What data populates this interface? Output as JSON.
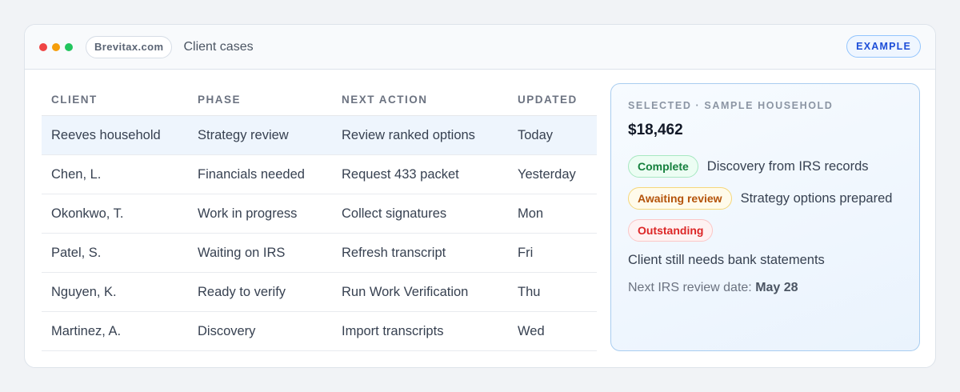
{
  "window": {
    "site": "Brevitax.com",
    "title": "Client cases",
    "badge": "EXAMPLE"
  },
  "table": {
    "headers": [
      "CLIENT",
      "PHASE",
      "NEXT ACTION",
      "UPDATED"
    ],
    "rows": [
      {
        "client": "Reeves household",
        "phase": "Strategy review",
        "next_action": "Review ranked options",
        "updated": "Today",
        "selected": true
      },
      {
        "client": "Chen, L.",
        "phase": "Financials needed",
        "next_action": "Request 433 packet",
        "updated": "Yesterday"
      },
      {
        "client": "Okonkwo, T.",
        "phase": "Work in progress",
        "next_action": "Collect signatures",
        "updated": "Mon"
      },
      {
        "client": "Patel, S.",
        "phase": "Waiting on IRS",
        "next_action": "Refresh transcript",
        "updated": "Fri"
      },
      {
        "client": "Nguyen, K.",
        "phase": "Ready to verify",
        "next_action": "Run Work Verification",
        "updated": "Thu"
      },
      {
        "client": "Martinez, A.",
        "phase": "Discovery",
        "next_action": "Import transcripts",
        "updated": "Wed"
      }
    ]
  },
  "panel": {
    "label": "SELECTED · SAMPLE HOUSEHOLD",
    "amount": "$18,462",
    "statuses": [
      {
        "badge": "Complete",
        "text": "Discovery from IRS records",
        "tone": "complete"
      },
      {
        "badge": "Awaiting review",
        "text": "Strategy options prepared",
        "tone": "awaiting"
      },
      {
        "badge": "Outstanding",
        "text": "",
        "tone": "outstanding"
      }
    ],
    "note": "Client still needs bank statements",
    "review_label": "Next IRS review date:",
    "review_date": "May 28"
  },
  "colors": {
    "accent": "#1d4ed8",
    "selected_row": "#eef5fd",
    "complete": "#15803d",
    "awaiting": "#b45309",
    "outstanding": "#dc2626"
  },
  "icons": [
    "close-dot",
    "minimize-dot",
    "zoom-dot"
  ]
}
